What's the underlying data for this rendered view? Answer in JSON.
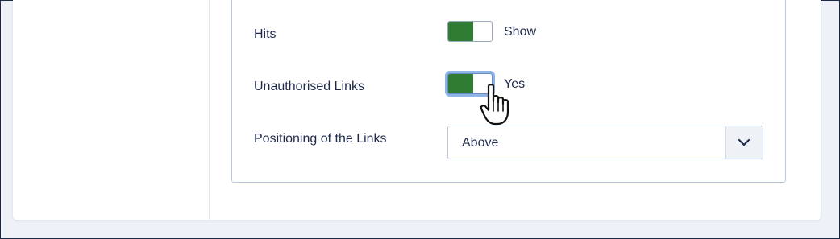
{
  "fields": {
    "hits": {
      "label": "Hits",
      "toggle_text": "Show",
      "value": true
    },
    "unauthorised_links": {
      "label": "Unauthorised Links",
      "toggle_text": "Yes",
      "value": true
    },
    "positioning": {
      "label": "Positioning of the Links",
      "selected": "Above"
    }
  },
  "colors": {
    "toggle_on": "#2e7d32",
    "text": "#1f2a4d",
    "border": "#b8c7d9",
    "focus_ring": "#8fb4e6"
  },
  "icons": {
    "select_caret": "chevron-down-icon",
    "cursor": "hand-pointer-icon"
  }
}
